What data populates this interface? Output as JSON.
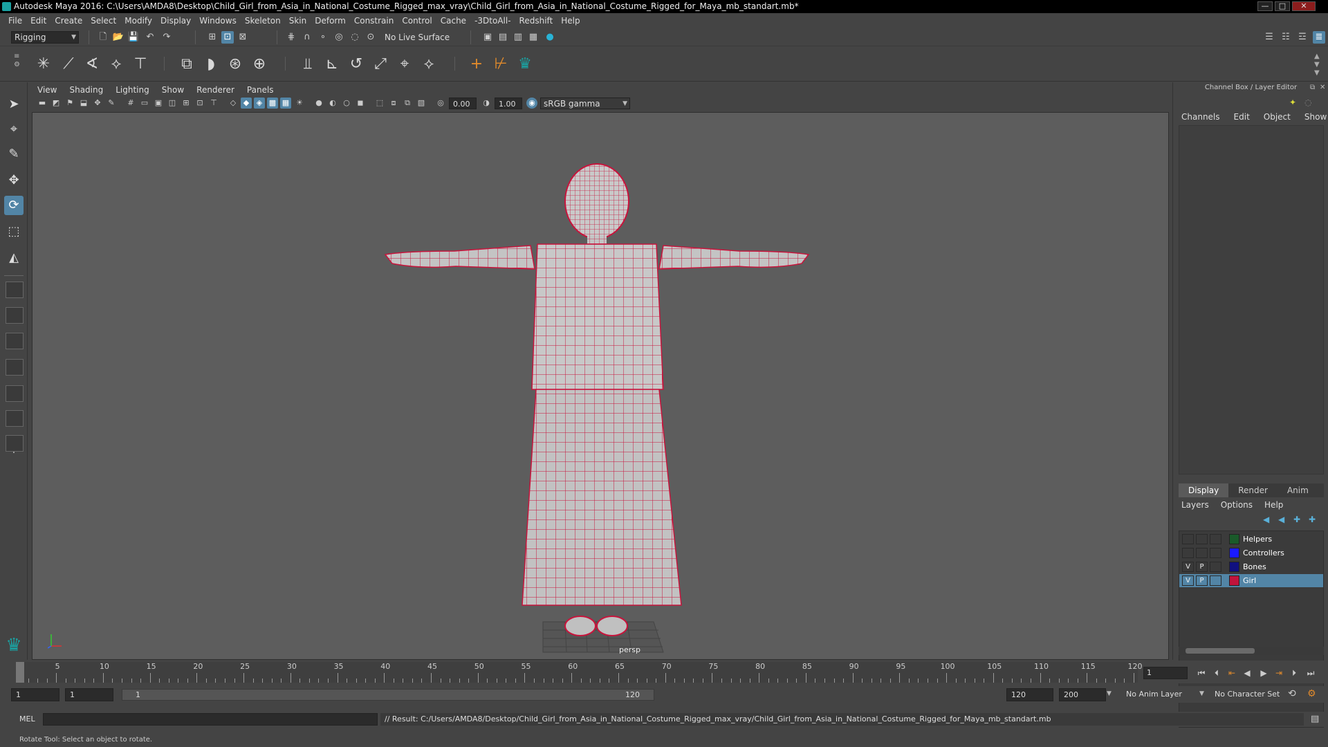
{
  "title_bar": {
    "title": "Autodesk Maya 2016: C:\\Users\\AMDA8\\Desktop\\Child_Girl_from_Asia_in_National_Costume_Rigged_max_vray\\Child_Girl_from_Asia_in_National_Costume_Rigged_for_Maya_mb_standart.mb*",
    "minimize": "—",
    "maximize": "□",
    "close": "✕"
  },
  "menubar": {
    "items": [
      "File",
      "Edit",
      "Create",
      "Select",
      "Modify",
      "Display",
      "Windows",
      "Skeleton",
      "Skin",
      "Deform",
      "Constrain",
      "Control",
      "Cache",
      "-3DtoAll-",
      "Redshift",
      "Help"
    ]
  },
  "statusline": {
    "menuset": "Rigging",
    "live_surface": "No Live Surface"
  },
  "panel": {
    "menus": [
      "View",
      "Shading",
      "Lighting",
      "Show",
      "Renderer",
      "Panels"
    ],
    "exposure": "0.00",
    "gamma": "1.00",
    "color_space": "sRGB gamma",
    "camera": "persp"
  },
  "channel_box": {
    "title": "Channel Box / Layer Editor",
    "menus": [
      "Channels",
      "Edit",
      "Object",
      "Show"
    ],
    "layer_tabs": [
      "Display",
      "Render",
      "Anim"
    ],
    "active_tab": "Display",
    "layer_menus": [
      "Layers",
      "Options",
      "Help"
    ],
    "layers": [
      {
        "name": "Helpers",
        "v": "",
        "p": "",
        "color": "#1a5a2a",
        "selected": false
      },
      {
        "name": "Controllers",
        "v": "",
        "p": "",
        "color": "#1a1aff",
        "selected": false
      },
      {
        "name": "Bones",
        "v": "V",
        "p": "P",
        "color": "#101080",
        "selected": false
      },
      {
        "name": "Girl",
        "v": "V",
        "p": "P",
        "color": "#c0143c",
        "selected": true
      }
    ]
  },
  "timeline": {
    "start": 1,
    "end": 120,
    "tick_labels": [
      "1",
      "5",
      "10",
      "15",
      "20",
      "25",
      "30",
      "35",
      "40",
      "45",
      "50",
      "55",
      "60",
      "65",
      "70",
      "75",
      "80",
      "85",
      "90",
      "95",
      "100",
      "105",
      "110",
      "115",
      "120"
    ],
    "current_frame": "1"
  },
  "range": {
    "start": "1",
    "playback_start": "1",
    "range_start_label": "1",
    "range_end_label": "120",
    "playback_end": "120",
    "end": "200",
    "anim_layer": "No Anim Layer",
    "character_set": "No Character Set"
  },
  "command_line": {
    "mode": "MEL",
    "result": "// Result: C:/Users/AMDA8/Desktop/Child_Girl_from_Asia_in_National_Costume_Rigged_max_vray/Child_Girl_from_Asia_in_National_Costume_Rigged_for_Maya_mb_standart.mb"
  },
  "help_line": "Rotate Tool: Select an object to rotate.",
  "colors": {
    "accent": "#5285a6",
    "wireframe": "#c8143c",
    "viewport_bg": "#5d5d5d"
  }
}
